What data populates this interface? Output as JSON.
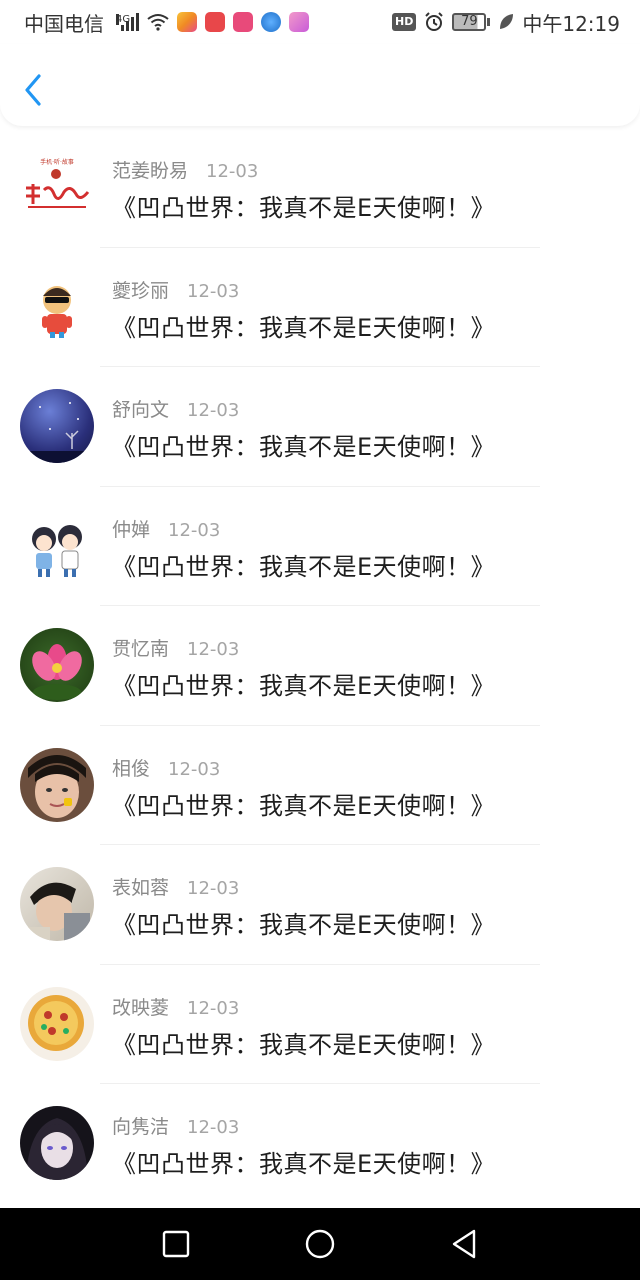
{
  "status_bar": {
    "carrier": "中国电信",
    "network": "4G",
    "battery": "79",
    "time": "中午12:19",
    "hd": "HD",
    "app_icons": [
      {
        "name": "app-icon-1",
        "color": "#f5a623"
      },
      {
        "name": "app-icon-2",
        "color": "#e8474a"
      },
      {
        "name": "app-icon-3",
        "color": "#e84a7a"
      },
      {
        "name": "app-icon-4",
        "color": "#2b86d9"
      },
      {
        "name": "app-icon-5",
        "color": "#e25aa8"
      }
    ]
  },
  "header": {
    "back_icon": "chevron-left-icon",
    "accent": "#2196f3"
  },
  "comments": [
    {
      "name": "范姜盼易",
      "date": "12-03",
      "title": "《凹凸世界：我真不是E天使啊！》",
      "avatar": "logo-red"
    },
    {
      "name": "夔珍丽",
      "date": "12-03",
      "title": "《凹凸世界：我真不是E天使啊！》",
      "avatar": "cartoon-kid"
    },
    {
      "name": "舒向文",
      "date": "12-03",
      "title": "《凹凸世界：我真不是E天使啊！》",
      "avatar": "night-sky"
    },
    {
      "name": "仲婵",
      "date": "12-03",
      "title": "《凹凸世界：我真不是E天使啊！》",
      "avatar": "anime-pair"
    },
    {
      "name": "贯忆南",
      "date": "12-03",
      "title": "《凹凸世界：我真不是E天使啊！》",
      "avatar": "lotus"
    },
    {
      "name": "相俊",
      "date": "12-03",
      "title": "《凹凸世界：我真不是E天使啊！》",
      "avatar": "face"
    },
    {
      "name": "表如蓉",
      "date": "12-03",
      "title": "《凹凸世界：我真不是E天使啊！》",
      "avatar": "photo"
    },
    {
      "name": "改映菱",
      "date": "12-03",
      "title": "《凹凸世界：我真不是E天使啊！》",
      "avatar": "pizza"
    },
    {
      "name": "向隽洁",
      "date": "12-03",
      "title": "《凹凸世界：我真不是E天使啊！》",
      "avatar": "anime-dark"
    }
  ],
  "nav": {
    "recent": "square-icon",
    "home": "circle-icon",
    "back": "triangle-back-icon"
  }
}
